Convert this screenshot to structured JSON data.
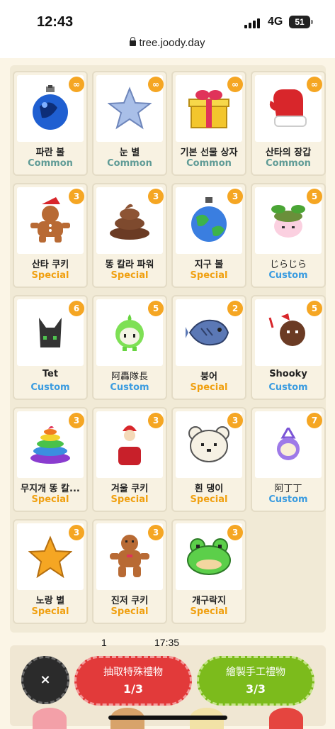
{
  "status": {
    "time": "12:43",
    "network": "4G",
    "battery": "51"
  },
  "browser": {
    "url": "tree.joody.day"
  },
  "gifts": [
    {
      "name": "파란 볼",
      "rarity": "Common",
      "badge": "∞"
    },
    {
      "name": "눈 별",
      "rarity": "Common",
      "badge": "∞"
    },
    {
      "name": "기본 선물 상자",
      "rarity": "Common",
      "badge": "∞"
    },
    {
      "name": "산타의 장갑",
      "rarity": "Common",
      "badge": "∞"
    },
    {
      "name": "산타 쿠키",
      "rarity": "Special",
      "badge": "3"
    },
    {
      "name": "똥 칼라 파워",
      "rarity": "Special",
      "badge": "3"
    },
    {
      "name": "지구 볼",
      "rarity": "Special",
      "badge": "3"
    },
    {
      "name": "じらじら",
      "rarity": "Custom",
      "badge": "5"
    },
    {
      "name": "Tet",
      "rarity": "Custom",
      "badge": "6"
    },
    {
      "name": "阿轟隊長",
      "rarity": "Custom",
      "badge": "5"
    },
    {
      "name": "붕어",
      "rarity": "Special",
      "badge": "2"
    },
    {
      "name": "Shooky",
      "rarity": "Custom",
      "badge": "5"
    },
    {
      "name": "무지개 똥 칼...",
      "rarity": "Special",
      "badge": "3"
    },
    {
      "name": "겨울 쿠키",
      "rarity": "Special",
      "badge": "3"
    },
    {
      "name": "흰 댕이",
      "rarity": "Special",
      "badge": "3"
    },
    {
      "name": "阿丁丁",
      "rarity": "Custom",
      "badge": "7"
    },
    {
      "name": "노랑 별",
      "rarity": "Special",
      "badge": "3"
    },
    {
      "name": "진저 쿠키",
      "rarity": "Special",
      "badge": "3"
    },
    {
      "name": "개구락지",
      "rarity": "Special",
      "badge": "3"
    }
  ],
  "overlay": {
    "count": "1",
    "time": "17:35"
  },
  "actions": {
    "close": "×",
    "draw_label": "抽取特殊禮物",
    "draw_count": "1/3",
    "craft_label": "繪製手工禮物",
    "craft_count": "3/3"
  },
  "colors": {
    "common": "#5f9b96",
    "special": "#f0a010",
    "custom": "#3b9ce0",
    "badge": "#f5a623",
    "draw": "#e23a3a",
    "craft": "#7cbb1c"
  }
}
